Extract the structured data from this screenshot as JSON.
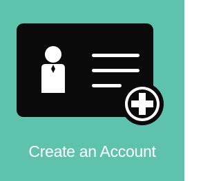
{
  "tile": {
    "label": "Create an Account",
    "icon": "id-card-add-icon",
    "badge_icon": "plus-circle-icon"
  },
  "colors": {
    "background": "#5fc2ad",
    "card": "#0a0a0a",
    "card_detail": "#ffffff",
    "label": "#ffffff"
  }
}
